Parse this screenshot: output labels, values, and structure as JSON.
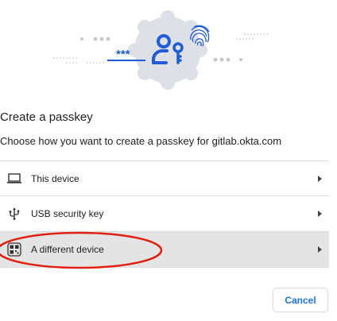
{
  "hero": {
    "passcode_text": "***",
    "illustration": "passkey-illustration"
  },
  "dialog": {
    "title": "Create a passkey",
    "subtitle": "Choose how you want to create a passkey for gitlab.okta.com",
    "cancel_label": "Cancel"
  },
  "options": [
    {
      "label": "This device",
      "icon": "laptop-icon"
    },
    {
      "label": "USB security key",
      "icon": "usb-icon"
    },
    {
      "label": "A different device",
      "icon": "qr-code-icon",
      "highlighted": true
    }
  ],
  "colors": {
    "accent": "#1a73e8",
    "illustration_blue": "#1f5cd6",
    "badge_gray": "#dde0e6",
    "annotation_red": "#e02010",
    "highlight_row": "#e4e4e4"
  }
}
